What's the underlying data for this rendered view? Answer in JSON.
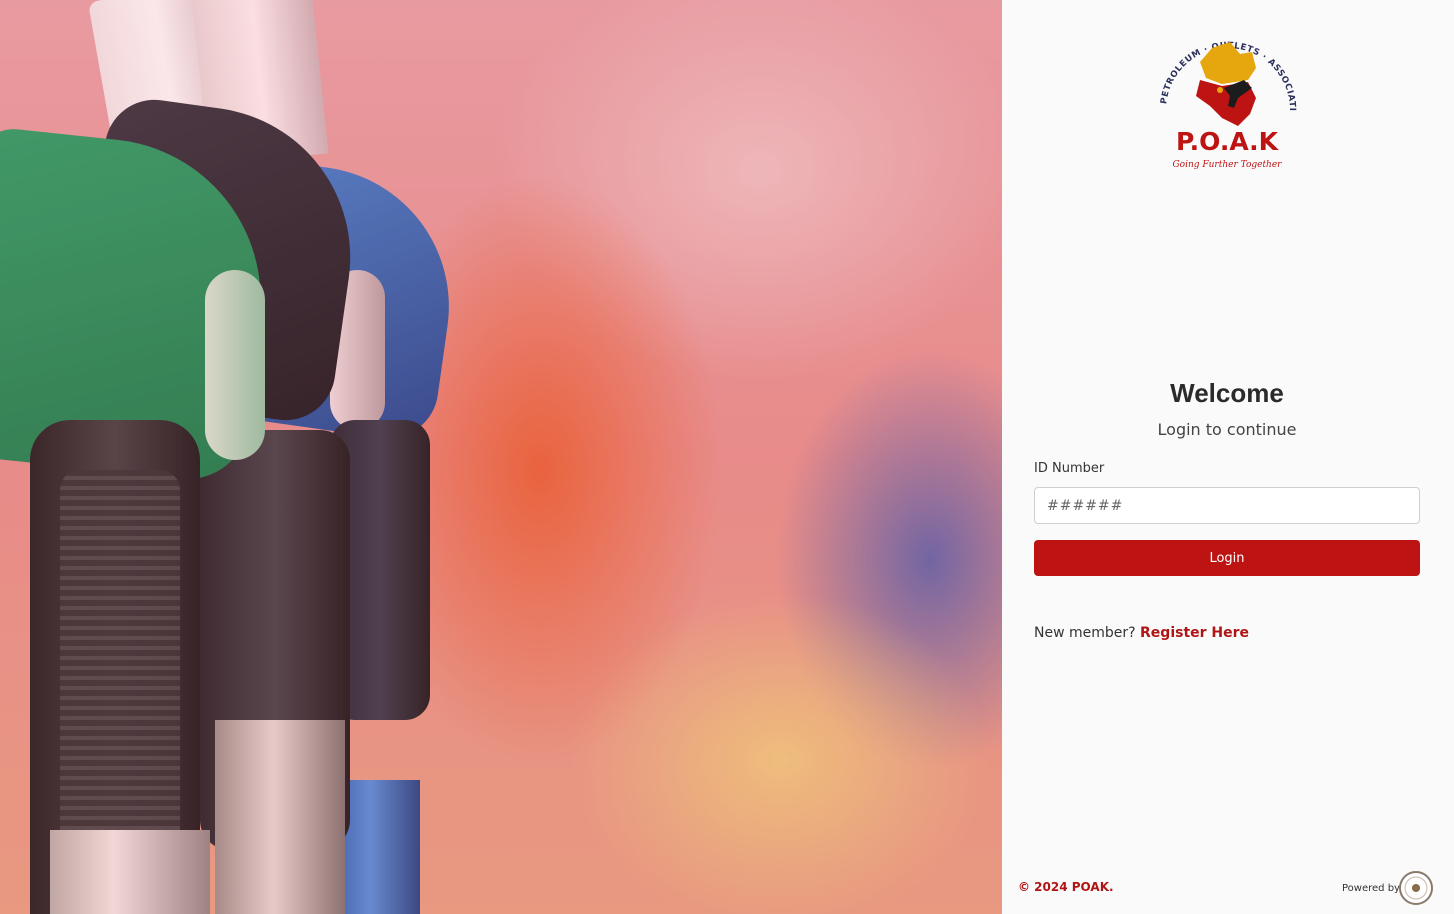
{
  "logo": {
    "arc_text": "PETROLEUM · OUTLETS · ASSOCIATION · OF · KENYA",
    "acronym": "P.O.A.K",
    "tagline": "Going Further Together",
    "colors": {
      "red": "#be1313",
      "gold": "#e5a70d",
      "navy": "#2a2f5c"
    }
  },
  "login": {
    "welcome": "Welcome",
    "subtitle": "Login to continue",
    "id_label": "ID Number",
    "id_placeholder": "######",
    "id_value": "",
    "login_button": "Login",
    "new_member_text": "New member?",
    "register_link": "Register Here"
  },
  "footer": {
    "copyright": "© 2024 POAK.",
    "powered_by": "Powered by"
  },
  "theme": {
    "accent": "#be1313",
    "panel_bg": "#fafafa"
  }
}
